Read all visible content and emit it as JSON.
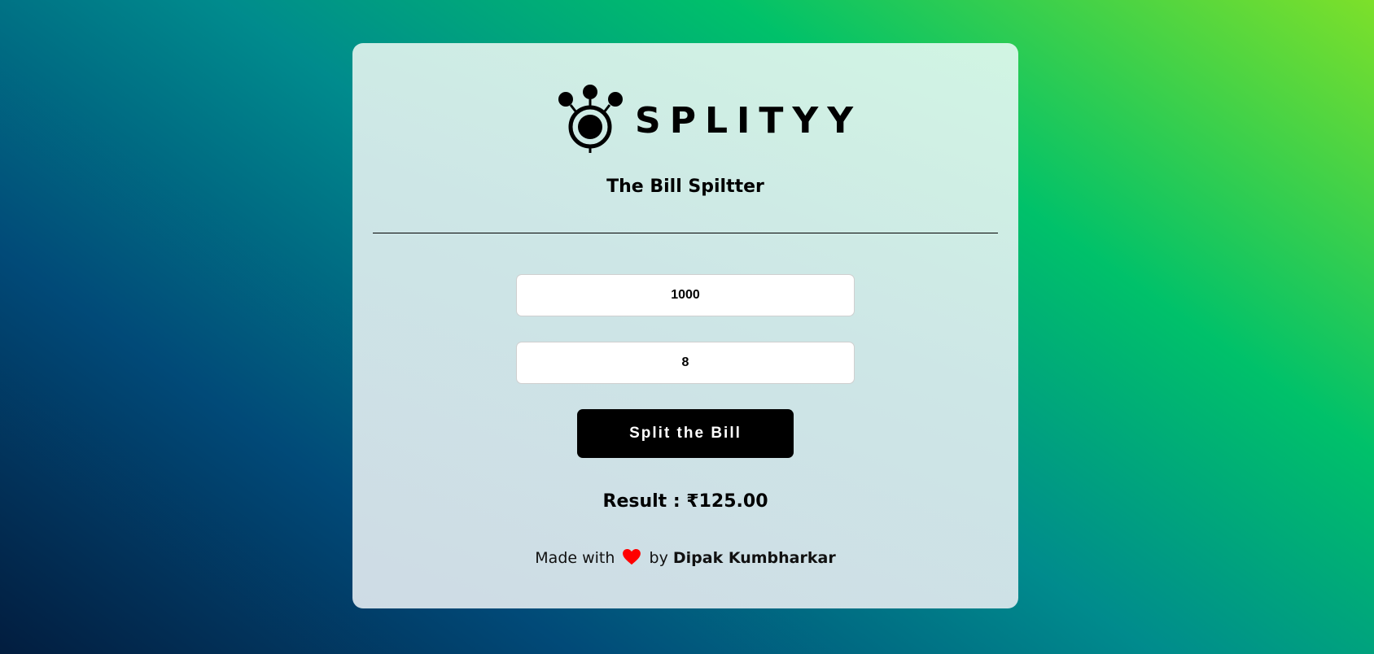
{
  "app": {
    "logo_text": "SPLITYY",
    "subtitle": "The Bill Spiltter"
  },
  "form": {
    "bill_value": "1000",
    "people_value": "8",
    "split_label": "Split the Bill"
  },
  "result": {
    "text": "Result : ₹125.00"
  },
  "footer": {
    "made_with": "Made with",
    "by": "by",
    "author": "Dipak Kumbharkar"
  },
  "colors": {
    "heart": "#ff0000",
    "button_bg": "#000000"
  },
  "icons": {
    "logo": "splityy-logo-icon",
    "heart": "heart-icon"
  }
}
